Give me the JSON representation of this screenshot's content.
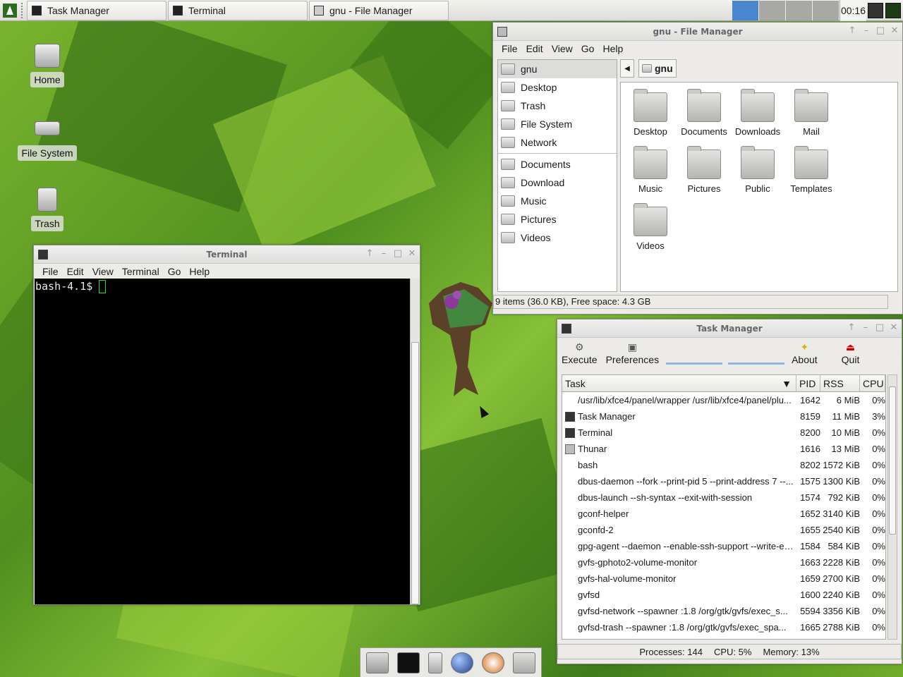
{
  "taskbar": {
    "tasks": [
      {
        "label": "Task Manager"
      },
      {
        "label": "Terminal"
      },
      {
        "label": "gnu - File Manager"
      }
    ],
    "clock": "00:16"
  },
  "desktop_icons": [
    {
      "label": "Home"
    },
    {
      "label": "File System"
    },
    {
      "label": "Trash"
    }
  ],
  "terminal": {
    "title": "Terminal",
    "menu": [
      "File",
      "Edit",
      "View",
      "Terminal",
      "Go",
      "Help"
    ],
    "prompt": "bash-4.1$ "
  },
  "file_manager": {
    "title": "gnu - File Manager",
    "menu": [
      "File",
      "Edit",
      "View",
      "Go",
      "Help"
    ],
    "sidebar_places": [
      "gnu",
      "Desktop",
      "Trash",
      "File System",
      "Network"
    ],
    "sidebar_bookmarks": [
      "Documents",
      "Download",
      "Music",
      "Pictures",
      "Videos"
    ],
    "crumb": "gnu",
    "items": [
      "Desktop",
      "Documents",
      "Downloads",
      "Mail",
      "Music",
      "Pictures",
      "Public",
      "Templates",
      "Videos"
    ],
    "status": "9 items (36.0 KB), Free space: 4.3 GB"
  },
  "task_manager": {
    "title": "Task Manager",
    "toolbar": {
      "execute": "Execute",
      "preferences": "Preferences",
      "about": "About",
      "quit": "Quit"
    },
    "columns": {
      "task": "Task",
      "pid": "PID",
      "rss": "RSS",
      "cpu": "CPU"
    },
    "rows": [
      {
        "task": "/usr/lib/xfce4/panel/wrapper /usr/lib/xfce4/panel/plu...",
        "pid": "1642",
        "rss": "6 MiB",
        "cpu": "0%",
        "icon": "none"
      },
      {
        "task": "Task Manager",
        "pid": "8159",
        "rss": "11 MiB",
        "cpu": "3%",
        "icon": "app"
      },
      {
        "task": "Terminal",
        "pid": "8200",
        "rss": "10 MiB",
        "cpu": "0%",
        "icon": "app"
      },
      {
        "task": "Thunar",
        "pid": "1616",
        "rss": "13 MiB",
        "cpu": "0%",
        "icon": "fm"
      },
      {
        "task": "bash",
        "pid": "8202",
        "rss": "1572 KiB",
        "cpu": "0%",
        "icon": "none"
      },
      {
        "task": "dbus-daemon --fork --print-pid 5 --print-address 7 --...",
        "pid": "1575",
        "rss": "1300 KiB",
        "cpu": "0%",
        "icon": "none"
      },
      {
        "task": "dbus-launch --sh-syntax --exit-with-session",
        "pid": "1574",
        "rss": "792 KiB",
        "cpu": "0%",
        "icon": "none"
      },
      {
        "task": "gconf-helper",
        "pid": "1652",
        "rss": "3140 KiB",
        "cpu": "0%",
        "icon": "none"
      },
      {
        "task": "gconfd-2",
        "pid": "1655",
        "rss": "2540 KiB",
        "cpu": "0%",
        "icon": "none"
      },
      {
        "task": "gpg-agent --daemon --enable-ssh-support --write-en...",
        "pid": "1584",
        "rss": "584 KiB",
        "cpu": "0%",
        "icon": "none"
      },
      {
        "task": "gvfs-gphoto2-volume-monitor",
        "pid": "1663",
        "rss": "2228 KiB",
        "cpu": "0%",
        "icon": "none"
      },
      {
        "task": "gvfs-hal-volume-monitor",
        "pid": "1659",
        "rss": "2700 KiB",
        "cpu": "0%",
        "icon": "none"
      },
      {
        "task": "gvfsd",
        "pid": "1600",
        "rss": "2240 KiB",
        "cpu": "0%",
        "icon": "none"
      },
      {
        "task": "gvfsd-network --spawner :1.8 /org/gtk/gvfs/exec_s...",
        "pid": "5594",
        "rss": "3356 KiB",
        "cpu": "0%",
        "icon": "none"
      },
      {
        "task": "gvfsd-trash --spawner :1.8 /org/gtk/gvfs/exec_spa...",
        "pid": "1665",
        "rss": "2788 KiB",
        "cpu": "0%",
        "icon": "none"
      }
    ],
    "status": {
      "processes": "Processes: 144",
      "cpu": "CPU: 5%",
      "memory": "Memory: 13%"
    }
  }
}
